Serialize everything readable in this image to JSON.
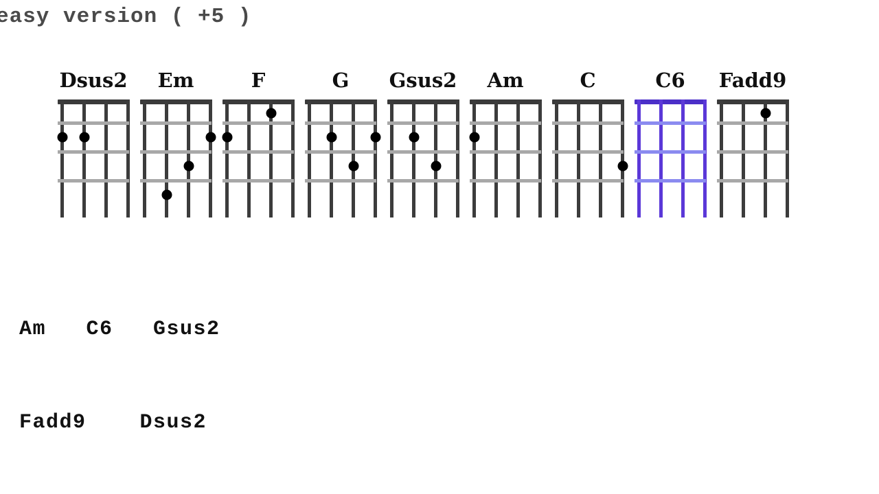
{
  "header": {
    "title": "easy version ( +5 )"
  },
  "chart": {
    "string_count": 4,
    "fret_count": 4,
    "colors": {
      "nut": "#3a3a3a",
      "string": "#3c3c3c",
      "fret": "#a8a8a8",
      "dot": "#000000",
      "highlight_nut": "#4b2fc8",
      "highlight_string": "#5b38d8",
      "highlight_fret": "#8b8bf0",
      "title_text": "#4a4a4a",
      "label_text": "#101010",
      "background": "#ffffff"
    },
    "diagrams": [
      {
        "name": "Dsus2",
        "highlight": false,
        "dots": [
          {
            "string": 1,
            "fret": 2
          },
          {
            "string": 2,
            "fret": 2
          }
        ]
      },
      {
        "name": "Em",
        "highlight": false,
        "dots": [
          {
            "string": 4,
            "fret": 2
          },
          {
            "string": 3,
            "fret": 3
          },
          {
            "string": 2,
            "fret": 4
          }
        ]
      },
      {
        "name": "F",
        "highlight": false,
        "dots": [
          {
            "string": 3,
            "fret": 1
          },
          {
            "string": 1,
            "fret": 2
          }
        ]
      },
      {
        "name": "G",
        "highlight": false,
        "dots": [
          {
            "string": 2,
            "fret": 2
          },
          {
            "string": 4,
            "fret": 2
          },
          {
            "string": 3,
            "fret": 3
          }
        ]
      },
      {
        "name": "Gsus2",
        "highlight": false,
        "dots": [
          {
            "string": 2,
            "fret": 2
          },
          {
            "string": 3,
            "fret": 3
          }
        ]
      },
      {
        "name": "Am",
        "highlight": false,
        "dots": [
          {
            "string": 1,
            "fret": 2
          }
        ]
      },
      {
        "name": "C",
        "highlight": false,
        "dots": [
          {
            "string": 4,
            "fret": 3
          }
        ]
      },
      {
        "name": "C6",
        "highlight": true,
        "dots": []
      },
      {
        "name": "Fadd9",
        "highlight": false,
        "dots": [
          {
            "string": 3,
            "fret": 1
          }
        ]
      }
    ]
  },
  "progression": {
    "line_1": "Am   C6   Gsus2",
    "line_2": "Fadd9    Dsus2"
  }
}
